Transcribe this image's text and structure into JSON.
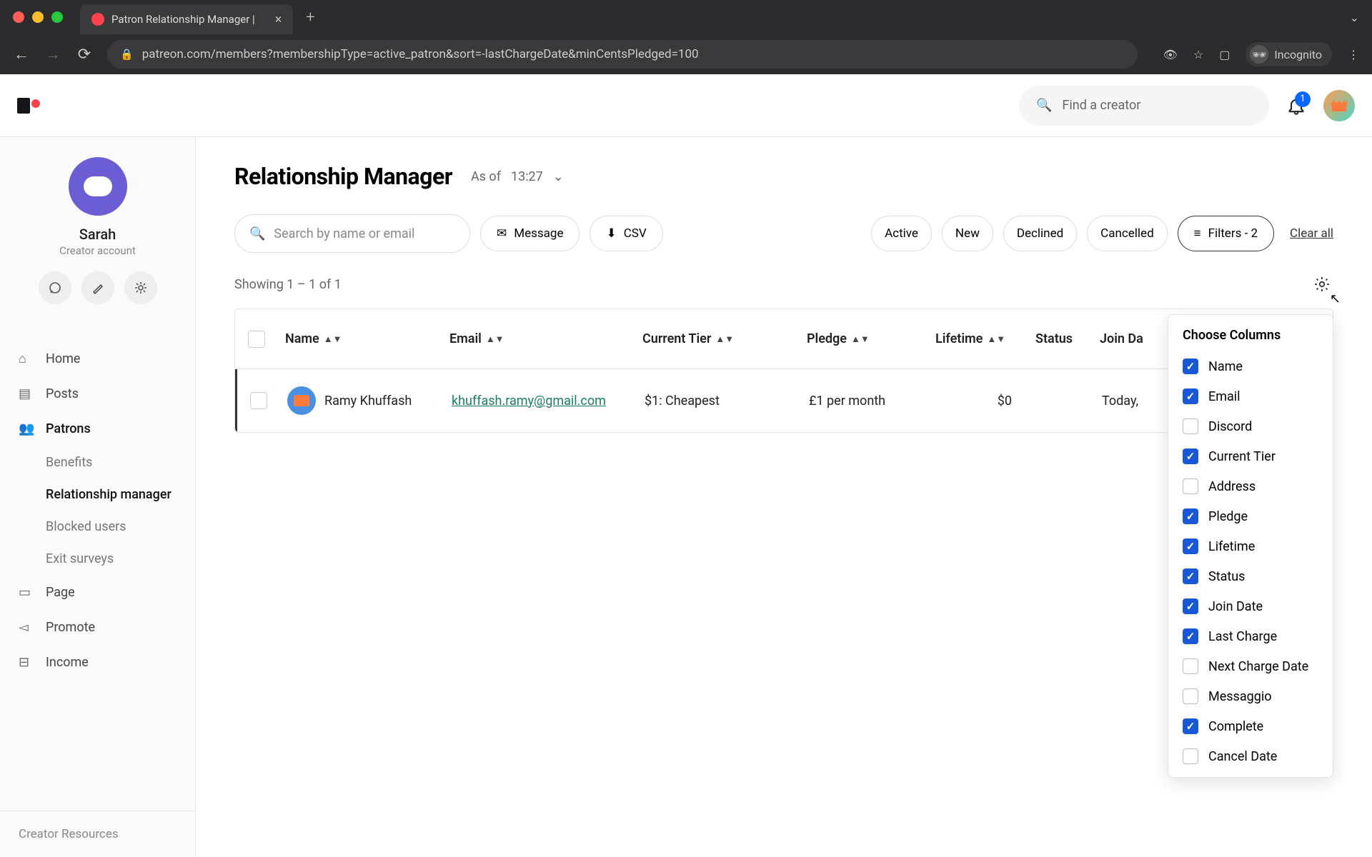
{
  "browser": {
    "tab_title": "Patron Relationship Manager |",
    "url": "patreon.com/members?membershipType=active_patron&sort=-lastChargeDate&minCentsPledged=100",
    "incognito_label": "Incognito"
  },
  "header": {
    "search_placeholder": "Find a creator",
    "notification_count": "1"
  },
  "sidebar": {
    "name": "Sarah",
    "subtitle": "Creator account",
    "nav": {
      "home": "Home",
      "posts": "Posts",
      "patrons": "Patrons",
      "benefits": "Benefits",
      "rel_mgr": "Relationship manager",
      "blocked": "Blocked users",
      "exit": "Exit surveys",
      "page": "Page",
      "promote": "Promote",
      "income": "Income"
    },
    "footer": "Creator Resources"
  },
  "page": {
    "title": "Relationship Manager",
    "asof_label": "As of",
    "asof_time": "13:27",
    "search_placeholder": "Search by name or email",
    "message_btn": "Message",
    "csv_btn": "CSV",
    "seg_active": "Active",
    "seg_new": "New",
    "seg_declined": "Declined",
    "seg_cancelled": "Cancelled",
    "filters_btn": "Filters - 2",
    "clear_all": "Clear all",
    "showing": "Showing 1 – 1 of 1",
    "columns_header": "Choose Columns"
  },
  "table": {
    "headers": {
      "name": "Name",
      "email": "Email",
      "tier": "Current Tier",
      "pledge": "Pledge",
      "lifetime": "Lifetime",
      "status": "Status",
      "join": "Join Da"
    },
    "row": {
      "name": "Ramy Khuffash",
      "email": "khuffash.ramy@gmail.com",
      "tier": "$1: Cheapest",
      "pledge": "£1 per month",
      "lifetime": "$0",
      "status": "",
      "join": "Today,"
    }
  },
  "columns_popover": [
    {
      "label": "Name",
      "checked": true
    },
    {
      "label": "Email",
      "checked": true
    },
    {
      "label": "Discord",
      "checked": false
    },
    {
      "label": "Current Tier",
      "checked": true
    },
    {
      "label": "Address",
      "checked": false
    },
    {
      "label": "Pledge",
      "checked": true
    },
    {
      "label": "Lifetime",
      "checked": true
    },
    {
      "label": "Status",
      "checked": true
    },
    {
      "label": "Join Date",
      "checked": true
    },
    {
      "label": "Last Charge",
      "checked": true
    },
    {
      "label": "Next Charge Date",
      "checked": false
    },
    {
      "label": "Messaggio",
      "checked": false
    },
    {
      "label": "Complete",
      "checked": true
    },
    {
      "label": "Cancel Date",
      "checked": false
    }
  ]
}
